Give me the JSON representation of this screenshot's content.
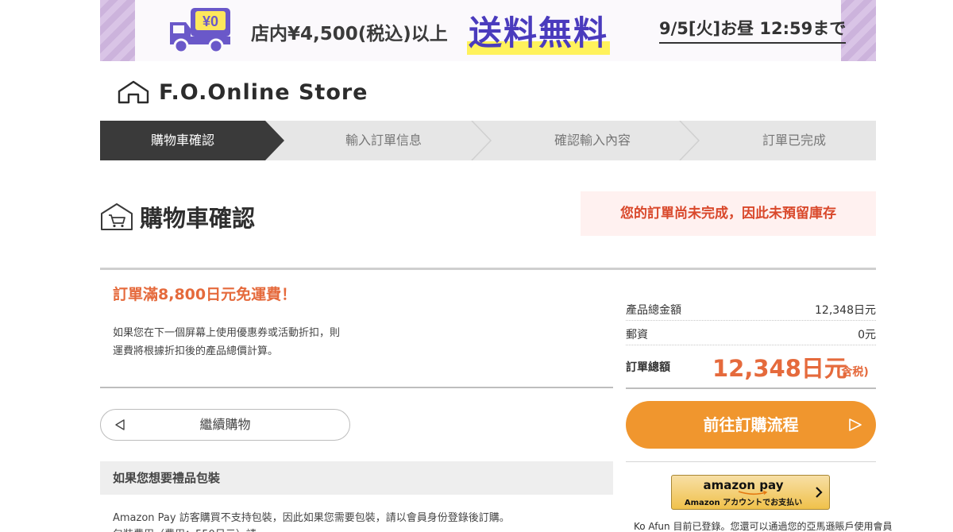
{
  "banner": {
    "badge": "¥0",
    "condition": "店内¥4,500(税込)以上",
    "headline": "送料無料",
    "deadline": "9/5[火]お昼 12:59まで"
  },
  "logo": {
    "text": "F.O.Online Store"
  },
  "steps": [
    {
      "label": "購物車確認",
      "active": true
    },
    {
      "label": "輸入訂單信息",
      "active": false
    },
    {
      "label": "確認輸入內容",
      "active": false
    },
    {
      "label": "訂單已完成",
      "active": false
    }
  ],
  "page": {
    "title": "購物車確認",
    "notice": "您的訂單尚未完成，因此未預留庫存"
  },
  "shipping": {
    "headline": "訂單滿8,800日元免運費！",
    "note_line1": "如果您在下一個屏幕上使用優惠券或活動折扣，則",
    "note_line2": "運費將根據折扣後的產品總價計算。"
  },
  "continue_button": {
    "label": "繼續購物"
  },
  "gift": {
    "title": "如果您想要禮品包裝",
    "note_line1": "Amazon Pay 訪客購買不支持包裝，因此如果您需要包裝，請以會員身份登錄後訂購。",
    "note_line2": "包裝費用（費用：550日元）請"
  },
  "summary": {
    "subtotal_label": "產品總金額",
    "subtotal_value": "12,348日元",
    "postage_label": "郵資",
    "postage_value": "0元",
    "total_label": "訂單總額",
    "total_value": "12,348日元",
    "total_tax": "(含税)"
  },
  "checkout_button": {
    "label": "前往訂購流程"
  },
  "amazon_pay": {
    "brand": "amazon pay",
    "sub": "Amazon アカウントでお支払い",
    "note": "Ko Afun 目前已登錄。您還可以通過您的亞馬遜賬戶使用會員"
  },
  "colors": {
    "accent_orange": "#f0962e",
    "price_orange": "#e56a3c",
    "banner_purple": "#4a3bbd",
    "active_step": "#3a3a3a"
  }
}
